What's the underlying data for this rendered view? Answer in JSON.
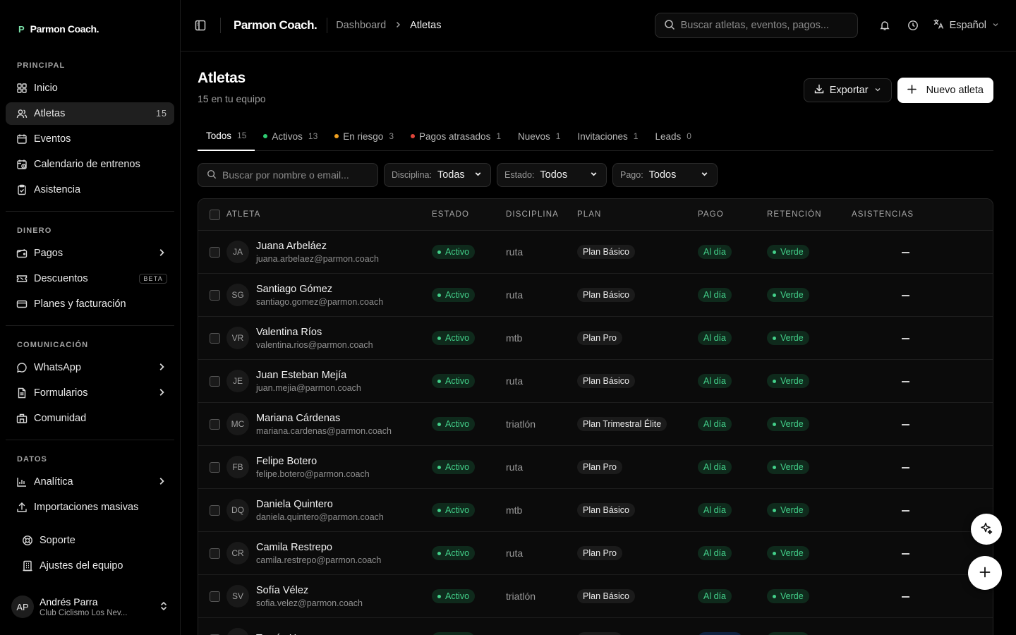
{
  "brand": {
    "mark": "P",
    "name": "Parmon Coach."
  },
  "sidebar": {
    "sections": [
      {
        "label": "PRINCIPAL",
        "items": [
          {
            "label": "Inicio",
            "icon": "grid-icon"
          },
          {
            "label": "Atletas",
            "icon": "users-icon",
            "count": "15",
            "active": true
          },
          {
            "label": "Eventos",
            "icon": "calendar-icon"
          },
          {
            "label": "Calendario de entrenos",
            "icon": "calendar-clock-icon"
          },
          {
            "label": "Asistencia",
            "icon": "clipboard-check-icon"
          }
        ]
      },
      {
        "label": "DINERO",
        "items": [
          {
            "label": "Pagos",
            "icon": "wallet-icon",
            "chevron": true
          },
          {
            "label": "Descuentos",
            "icon": "ticket-icon",
            "badge": "BETA"
          },
          {
            "label": "Planes y facturación",
            "icon": "card-icon"
          }
        ]
      },
      {
        "label": "COMUNICACIÓN",
        "items": [
          {
            "label": "WhatsApp",
            "icon": "chat-icon",
            "chevron": true
          },
          {
            "label": "Formularios",
            "icon": "form-icon",
            "chevron": true
          },
          {
            "label": "Comunidad",
            "icon": "community-icon"
          }
        ]
      },
      {
        "label": "DATOS",
        "items": [
          {
            "label": "Analítica",
            "icon": "chart-icon",
            "chevron": true
          },
          {
            "label": "Importaciones masivas",
            "icon": "upload-icon"
          }
        ]
      }
    ],
    "bottom": [
      {
        "label": "Soporte",
        "icon": "lifebuoy-icon"
      },
      {
        "label": "Ajustes del equipo",
        "icon": "building-icon"
      }
    ],
    "user": {
      "initials": "AP",
      "name": "Andrés Parra",
      "club": "Club Ciclismo Los Nev..."
    }
  },
  "topbar": {
    "title": "Parmon Coach.",
    "breadcrumb": [
      "Dashboard",
      "Atletas"
    ],
    "search_placeholder": "Buscar atletas, eventos, pagos...",
    "language": "Español"
  },
  "page": {
    "title": "Atletas",
    "subtitle": "15 en tu equipo",
    "export_label": "Exportar",
    "new_label": "Nuevo atleta"
  },
  "tabs": [
    {
      "label": "Todos",
      "count": "15",
      "active": true,
      "dot": ""
    },
    {
      "label": "Activos",
      "count": "13",
      "dot": "#2ecc71"
    },
    {
      "label": "En riesgo",
      "count": "3",
      "dot": "#f0a020"
    },
    {
      "label": "Pagos atrasados",
      "count": "1",
      "dot": "#e0453a"
    },
    {
      "label": "Nuevos",
      "count": "1",
      "dot": ""
    },
    {
      "label": "Invitaciones",
      "count": "1",
      "dot": ""
    },
    {
      "label": "Leads",
      "count": "0",
      "dot": ""
    }
  ],
  "filters": {
    "search_placeholder": "Buscar por nombre o email...",
    "disciplina": {
      "label": "Disciplina:",
      "value": "Todas"
    },
    "estado": {
      "label": "Estado:",
      "value": "Todos"
    },
    "pago": {
      "label": "Pago:",
      "value": "Todos"
    }
  },
  "table": {
    "columns": [
      "ATLETA",
      "ESTADO",
      "DISCIPLINA",
      "PLAN",
      "PAGO",
      "RETENCIÓN",
      "ASISTENCIAS"
    ],
    "rows": [
      {
        "initials": "JA",
        "name": "Juana Arbeláez",
        "email": "juana.arbelaez@parmon.coach",
        "estado": "Activo",
        "disciplina": "ruta",
        "plan": "Plan Básico",
        "pago": "Al día",
        "retencion": "Verde"
      },
      {
        "initials": "SG",
        "name": "Santiago Gómez",
        "email": "santiago.gomez@parmon.coach",
        "estado": "Activo",
        "disciplina": "ruta",
        "plan": "Plan Básico",
        "pago": "Al día",
        "retencion": "Verde"
      },
      {
        "initials": "VR",
        "name": "Valentina Ríos",
        "email": "valentina.rios@parmon.coach",
        "estado": "Activo",
        "disciplina": "mtb",
        "plan": "Plan Pro",
        "pago": "Al día",
        "retencion": "Verde"
      },
      {
        "initials": "JE",
        "name": "Juan Esteban Mejía",
        "email": "juan.mejia@parmon.coach",
        "estado": "Activo",
        "disciplina": "ruta",
        "plan": "Plan Básico",
        "pago": "Al día",
        "retencion": "Verde"
      },
      {
        "initials": "MC",
        "name": "Mariana Cárdenas",
        "email": "mariana.cardenas@parmon.coach",
        "estado": "Activo",
        "disciplina": "triatlón",
        "plan": "Plan Trimestral Élite",
        "pago": "Al día",
        "retencion": "Verde"
      },
      {
        "initials": "FB",
        "name": "Felipe Botero",
        "email": "felipe.botero@parmon.coach",
        "estado": "Activo",
        "disciplina": "ruta",
        "plan": "Plan Pro",
        "pago": "Al día",
        "retencion": "Verde"
      },
      {
        "initials": "DQ",
        "name": "Daniela Quintero",
        "email": "daniela.quintero@parmon.coach",
        "estado": "Activo",
        "disciplina": "mtb",
        "plan": "Plan Básico",
        "pago": "Al día",
        "retencion": "Verde"
      },
      {
        "initials": "CR",
        "name": "Camila Restrepo",
        "email": "camila.restrepo@parmon.coach",
        "estado": "Activo",
        "disciplina": "ruta",
        "plan": "Plan Pro",
        "pago": "Al día",
        "retencion": "Verde"
      },
      {
        "initials": "SV",
        "name": "Sofía Vélez",
        "email": "sofia.velez@parmon.coach",
        "estado": "Activo",
        "disciplina": "triatlón",
        "plan": "Plan Básico",
        "pago": "Al día",
        "retencion": "Verde"
      },
      {
        "initials": "TH",
        "name": "Tomás Henao",
        "email": "",
        "estado": "Activo",
        "disciplina": "ruta",
        "plan": "Plan Pro",
        "pago": "Cortesía",
        "retencion": "Verde"
      }
    ]
  }
}
